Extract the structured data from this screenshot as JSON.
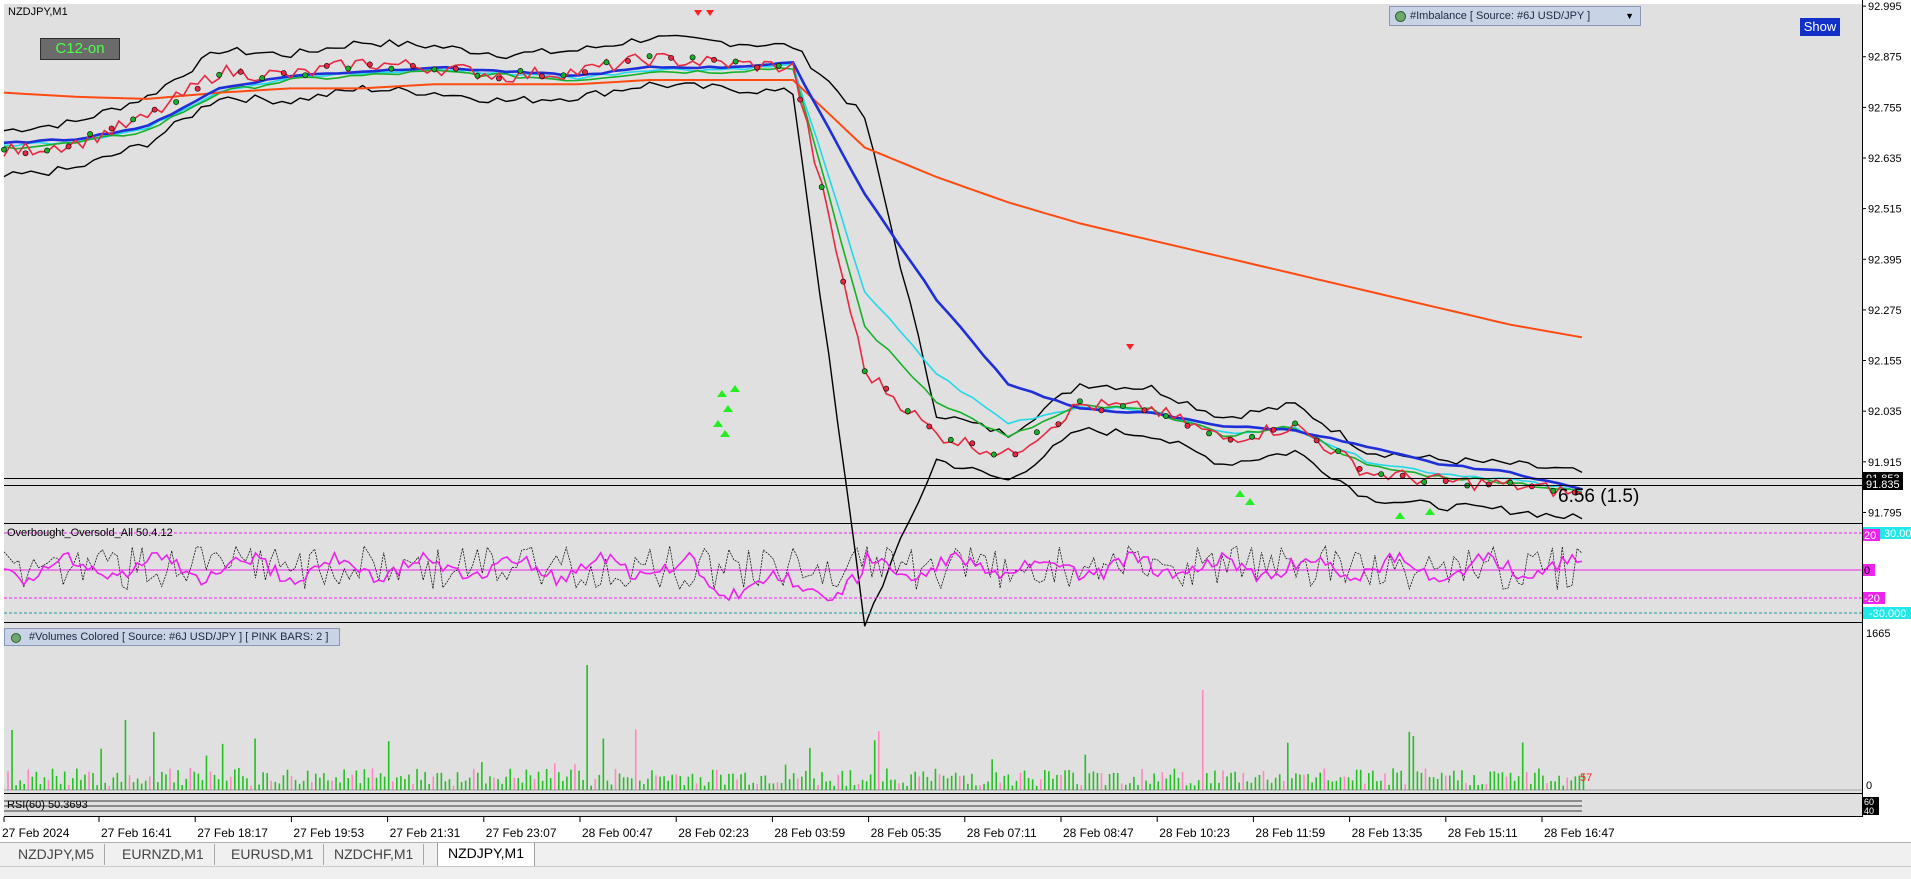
{
  "window": {
    "symbol_title": "NZDJPY,M1"
  },
  "buttons": {
    "c12": "C12-on",
    "show": "Show"
  },
  "imbalance_label": "#Imbalance [ Source: #6J USD/JPY ]",
  "volumes_label": "#Volumes Colored [ Source: #6J USD/JPY ]  [ PINK BARS: 2 ]",
  "oscillator_label": "Overbought_Oversold_All 50.4.12",
  "rsi_label": "RSI(60) 50.3693",
  "last_price_box": "91.853",
  "last_price_box2": "91.835",
  "pips_label": "6.56 (1.5)",
  "volume_last": "57",
  "oscillator_levels": {
    "top": "30.000",
    "upper": "20",
    "zero": "0",
    "lower": "-20",
    "bottom": "-30.000"
  },
  "volume_scale": {
    "max": "1665",
    "min": "0"
  },
  "rsi_scale": {
    "upper": "60",
    "lower": "40"
  },
  "tabs": [
    {
      "label": "NZDJPY,M5",
      "active": false
    },
    {
      "label": "EURNZD,M1",
      "active": false
    },
    {
      "label": "EURUSD,M1",
      "active": false
    },
    {
      "label": "NZDCHF,M1",
      "active": false
    },
    {
      "label": "NZDJPY,M1",
      "active": true
    }
  ],
  "colors": {
    "background": "#e0e0e0",
    "ema_slow": "#ff4a10",
    "ema_mid": "#1f2fd8",
    "ema_cyan": "#22d8e8",
    "ema_green": "#18b028",
    "ema_red": "#e82840",
    "bands": "#000000",
    "oscillator": "#ee22ee",
    "vol_green": "#22c022",
    "vol_pink": "#ff88c0"
  },
  "chart_data": {
    "type": "line",
    "title": "NZDJPY,M1",
    "x_tick_labels": [
      "27 Feb 2024",
      "27 Feb 16:41",
      "27 Feb 18:17",
      "27 Feb 19:53",
      "27 Feb 21:31",
      "27 Feb 23:07",
      "28 Feb 00:47",
      "28 Feb 02:23",
      "28 Feb 03:59",
      "28 Feb 05:35",
      "28 Feb 07:11",
      "28 Feb 08:47",
      "28 Feb 10:23",
      "28 Feb 11:59",
      "28 Feb 13:35",
      "28 Feb 15:11",
      "28 Feb 16:47"
    ],
    "y_tick_labels": [
      "92.995",
      "92.875",
      "92.755",
      "92.635",
      "92.515",
      "92.395",
      "92.275",
      "92.155",
      "92.035",
      "91.915",
      "91.795"
    ],
    "ylim": [
      91.77,
      93.0
    ],
    "grid": false,
    "series": [
      {
        "color": "#ff4a10",
        "values": [
          92.79,
          92.78,
          92.775,
          92.79,
          92.8,
          92.8,
          92.81,
          92.81,
          92.81,
          92.82,
          92.82,
          92.82,
          92.66,
          92.59,
          92.53,
          92.48,
          92.44,
          92.4,
          92.36,
          92.32,
          92.28,
          92.24,
          92.21
        ]
      },
      {
        "color": "#1f2fd8",
        "values": [
          92.67,
          92.68,
          92.71,
          92.8,
          92.83,
          92.84,
          92.85,
          92.84,
          92.83,
          92.85,
          92.85,
          92.86,
          92.55,
          92.3,
          92.1,
          92.04,
          92.03,
          92.0,
          91.99,
          91.95,
          91.91,
          91.89,
          91.85
        ]
      },
      {
        "color": "#e82840",
        "values": [
          92.65,
          92.67,
          92.73,
          92.84,
          92.83,
          92.86,
          92.85,
          92.83,
          92.84,
          92.87,
          92.86,
          92.85,
          92.13,
          91.98,
          91.93,
          92.05,
          92.04,
          91.97,
          92.0,
          91.89,
          91.87,
          91.86,
          91.84
        ]
      }
    ]
  }
}
